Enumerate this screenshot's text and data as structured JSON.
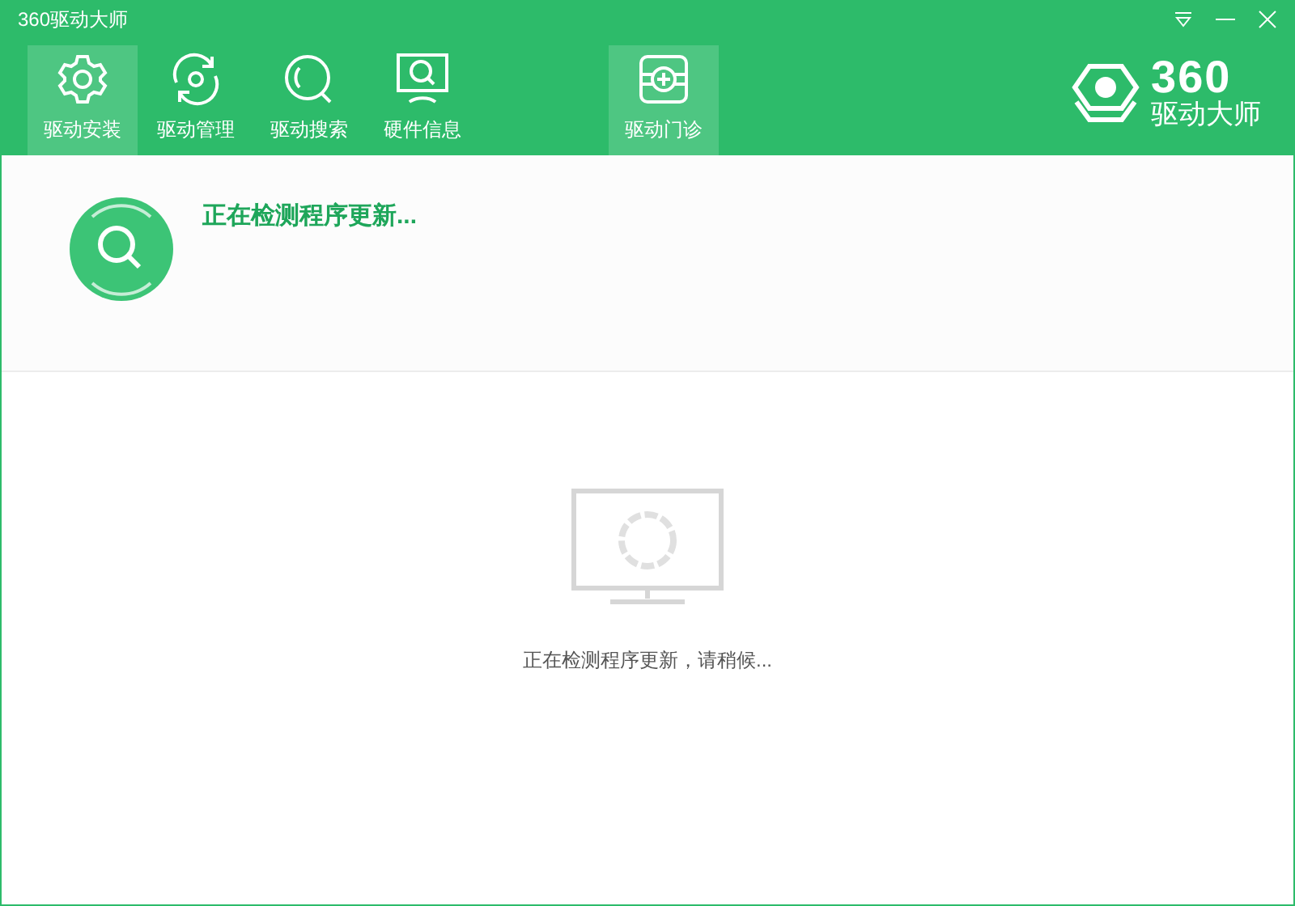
{
  "window": {
    "title": "360驱动大师"
  },
  "tabs": [
    {
      "label": "驱动安装",
      "selected": true
    },
    {
      "label": "驱动管理",
      "selected": false
    },
    {
      "label": "驱动搜索",
      "selected": false
    },
    {
      "label": "硬件信息",
      "selected": false
    }
  ],
  "clinic_button": {
    "label": "驱动门诊"
  },
  "logo": {
    "number": "360",
    "name": "驱动大师"
  },
  "status": {
    "title": "正在检测程序更新..."
  },
  "loading": {
    "message": "正在检测程序更新，请稍候..."
  }
}
